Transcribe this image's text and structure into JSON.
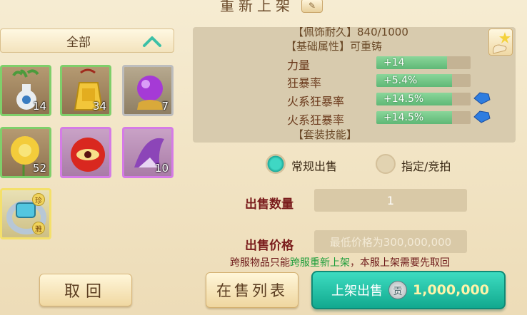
{
  "header": {
    "title": "重新上架"
  },
  "category": {
    "label": "全部"
  },
  "inventory": [
    {
      "name": "vase",
      "count": "14"
    },
    {
      "name": "golden-bell",
      "count": "34"
    },
    {
      "name": "purple-orb",
      "count": "7"
    },
    {
      "name": "golden-flower",
      "count": "52"
    },
    {
      "name": "red-eye-orb",
      "count": ""
    },
    {
      "name": "purple-hat",
      "count": "10"
    },
    {
      "name": "silver-ring",
      "count": "",
      "badge_top": "珍",
      "badge_bottom": "雅"
    }
  ],
  "item_detail": {
    "line_top": "【佩饰耐久】840/1000",
    "base_title": "【基础属性】可重铸",
    "stats": [
      {
        "label": "力量",
        "value": "+14",
        "fill": 0.75
      },
      {
        "label": "狂暴率",
        "value": "+5.4%",
        "fill": 0.8
      },
      {
        "label": "火系狂暴率",
        "value": "+14.5%",
        "fill": 0.8
      },
      {
        "label": "火系狂暴率",
        "value": "+14.5%",
        "fill": 0.8
      }
    ],
    "set_title": "【套装技能】"
  },
  "sale_type": {
    "normal": "常规出售",
    "designated": "指定/竞拍",
    "selected": "normal"
  },
  "quantity": {
    "label": "出售数量",
    "value": "1"
  },
  "price": {
    "label": "出售价格",
    "placeholder": "最低价格为300,000,000"
  },
  "notice": {
    "before": "跨服物品只能",
    "highlight": "跨服重新上架",
    "after": "，本服上架需要先取回"
  },
  "buttons": {
    "cancel": "取回",
    "on_sale": "在售列表",
    "list": "上架出售",
    "coin_icon": "贡",
    "list_price": "1,000,000"
  },
  "colors": {
    "primary_button": "#21b9a0",
    "stat_bar": "#6cc384",
    "warning_text": "#6e1a1a",
    "highlight_text": "#1f9e3c"
  }
}
